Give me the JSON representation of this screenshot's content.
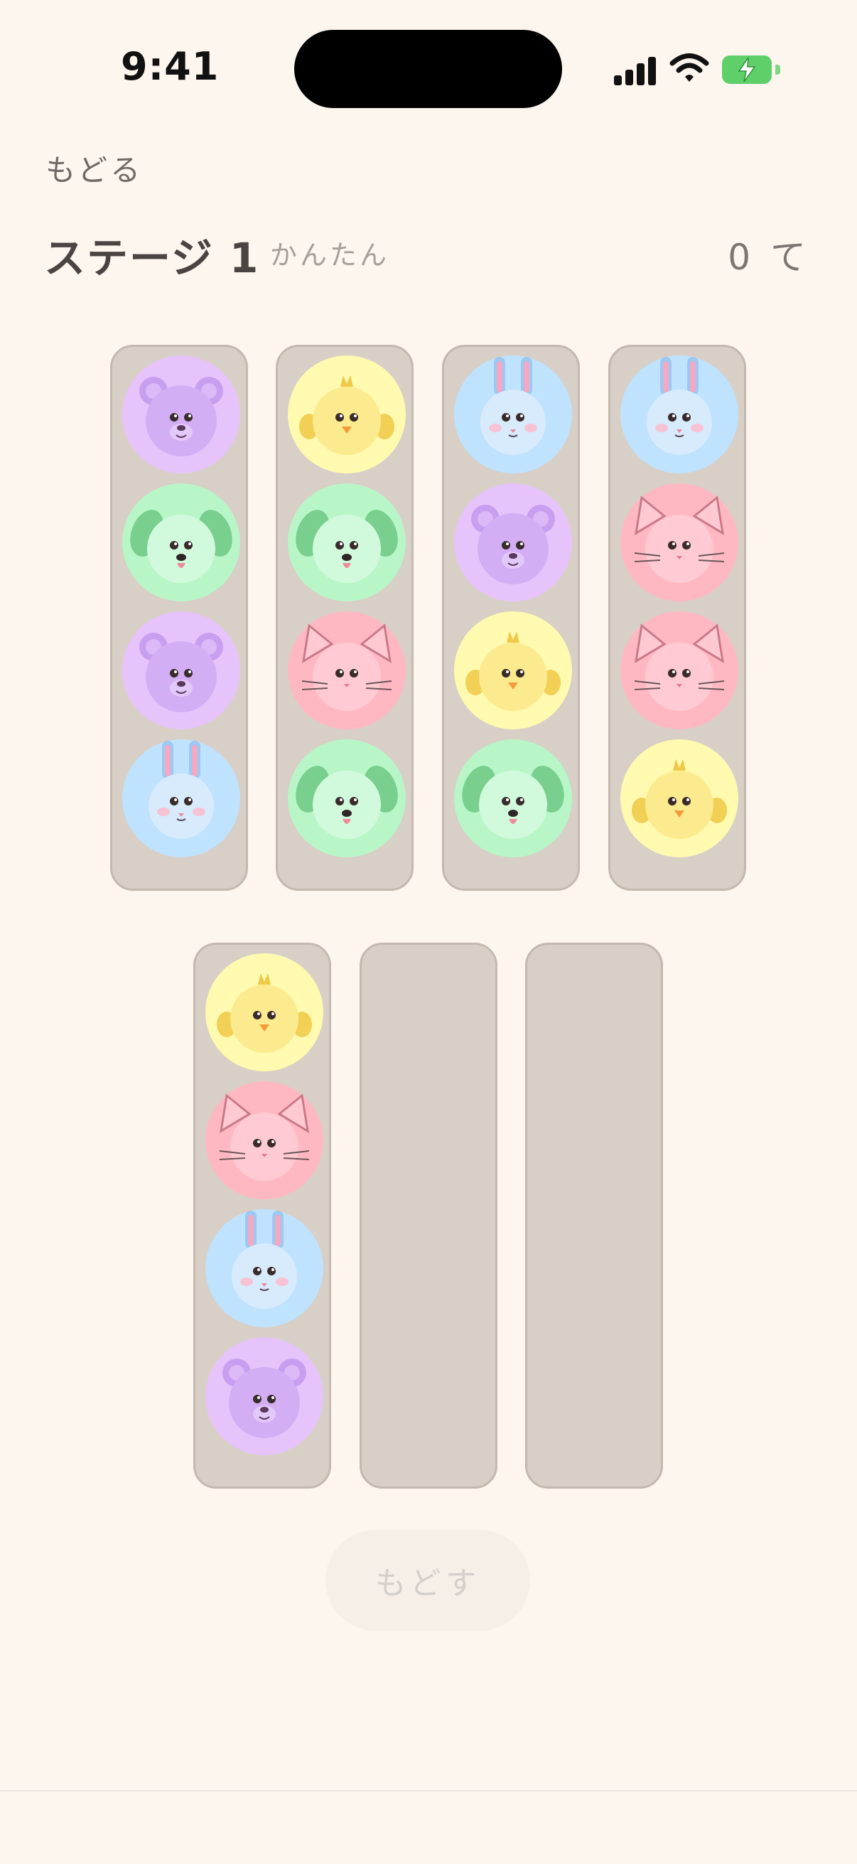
{
  "status_bar": {
    "time": "9:41"
  },
  "nav": {
    "back_label": "もどる"
  },
  "header": {
    "stage_title": "ステージ 1",
    "difficulty": "かんたん",
    "moves": "0 て"
  },
  "undo_label": "もどす",
  "animals": {
    "bear": {
      "icon": "bear-icon",
      "bg": "#e6c4fb"
    },
    "dog": {
      "icon": "dog-icon",
      "bg": "#b8f6c8"
    },
    "chick": {
      "icon": "chick-icon",
      "bg": "#fffab0"
    },
    "rabbit": {
      "icon": "rabbit-icon",
      "bg": "#bfe2fe"
    },
    "cat": {
      "icon": "cat-icon",
      "bg": "#ffb8c2"
    }
  },
  "tubes": [
    [
      "bear",
      "dog",
      "bear",
      "rabbit"
    ],
    [
      "chick",
      "dog",
      "cat",
      "dog"
    ],
    [
      "rabbit",
      "bear",
      "chick",
      "dog"
    ],
    [
      "rabbit",
      "cat",
      "cat",
      "chick"
    ],
    [
      "chick",
      "cat",
      "rabbit",
      "bear"
    ],
    [],
    []
  ]
}
